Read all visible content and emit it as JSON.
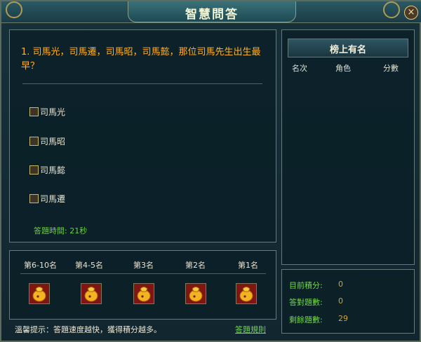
{
  "window": {
    "title": "智慧問答",
    "close_label": "×"
  },
  "question": {
    "text": "1. 司馬光，司馬遷，司馬昭，司馬懿，那位司馬先生出生最早？",
    "options": [
      {
        "label": "司馬光"
      },
      {
        "label": "司馬昭"
      },
      {
        "label": "司馬懿"
      },
      {
        "label": "司馬遷"
      }
    ],
    "answer_time": "答題時間: 21秒"
  },
  "ranking": {
    "title": "榜上有名",
    "columns": [
      "名次",
      "角色",
      "分數"
    ]
  },
  "rewards": {
    "tiers": [
      "第6-10名",
      "第4-5名",
      "第3名",
      "第2名",
      "第1名"
    ]
  },
  "stats": {
    "current_points_label": "目前積分:",
    "current_points_value": "0",
    "correct_answers_label": "答對題數:",
    "correct_answers_value": "0",
    "remaining_questions_label": "剩餘題數:",
    "remaining_questions_value": "29"
  },
  "footer": {
    "tip": "溫馨提示：答題速度越快，獲得積分越多。",
    "rules_link": "答題規則"
  },
  "colors": {
    "question_text": "#ffb127",
    "accent_green": "#69d13e",
    "panel_border": "#657b79",
    "reward_bag": "#f4b321"
  },
  "icons": {
    "reward_item": "gold-pouch-icon",
    "close": "close-icon"
  }
}
